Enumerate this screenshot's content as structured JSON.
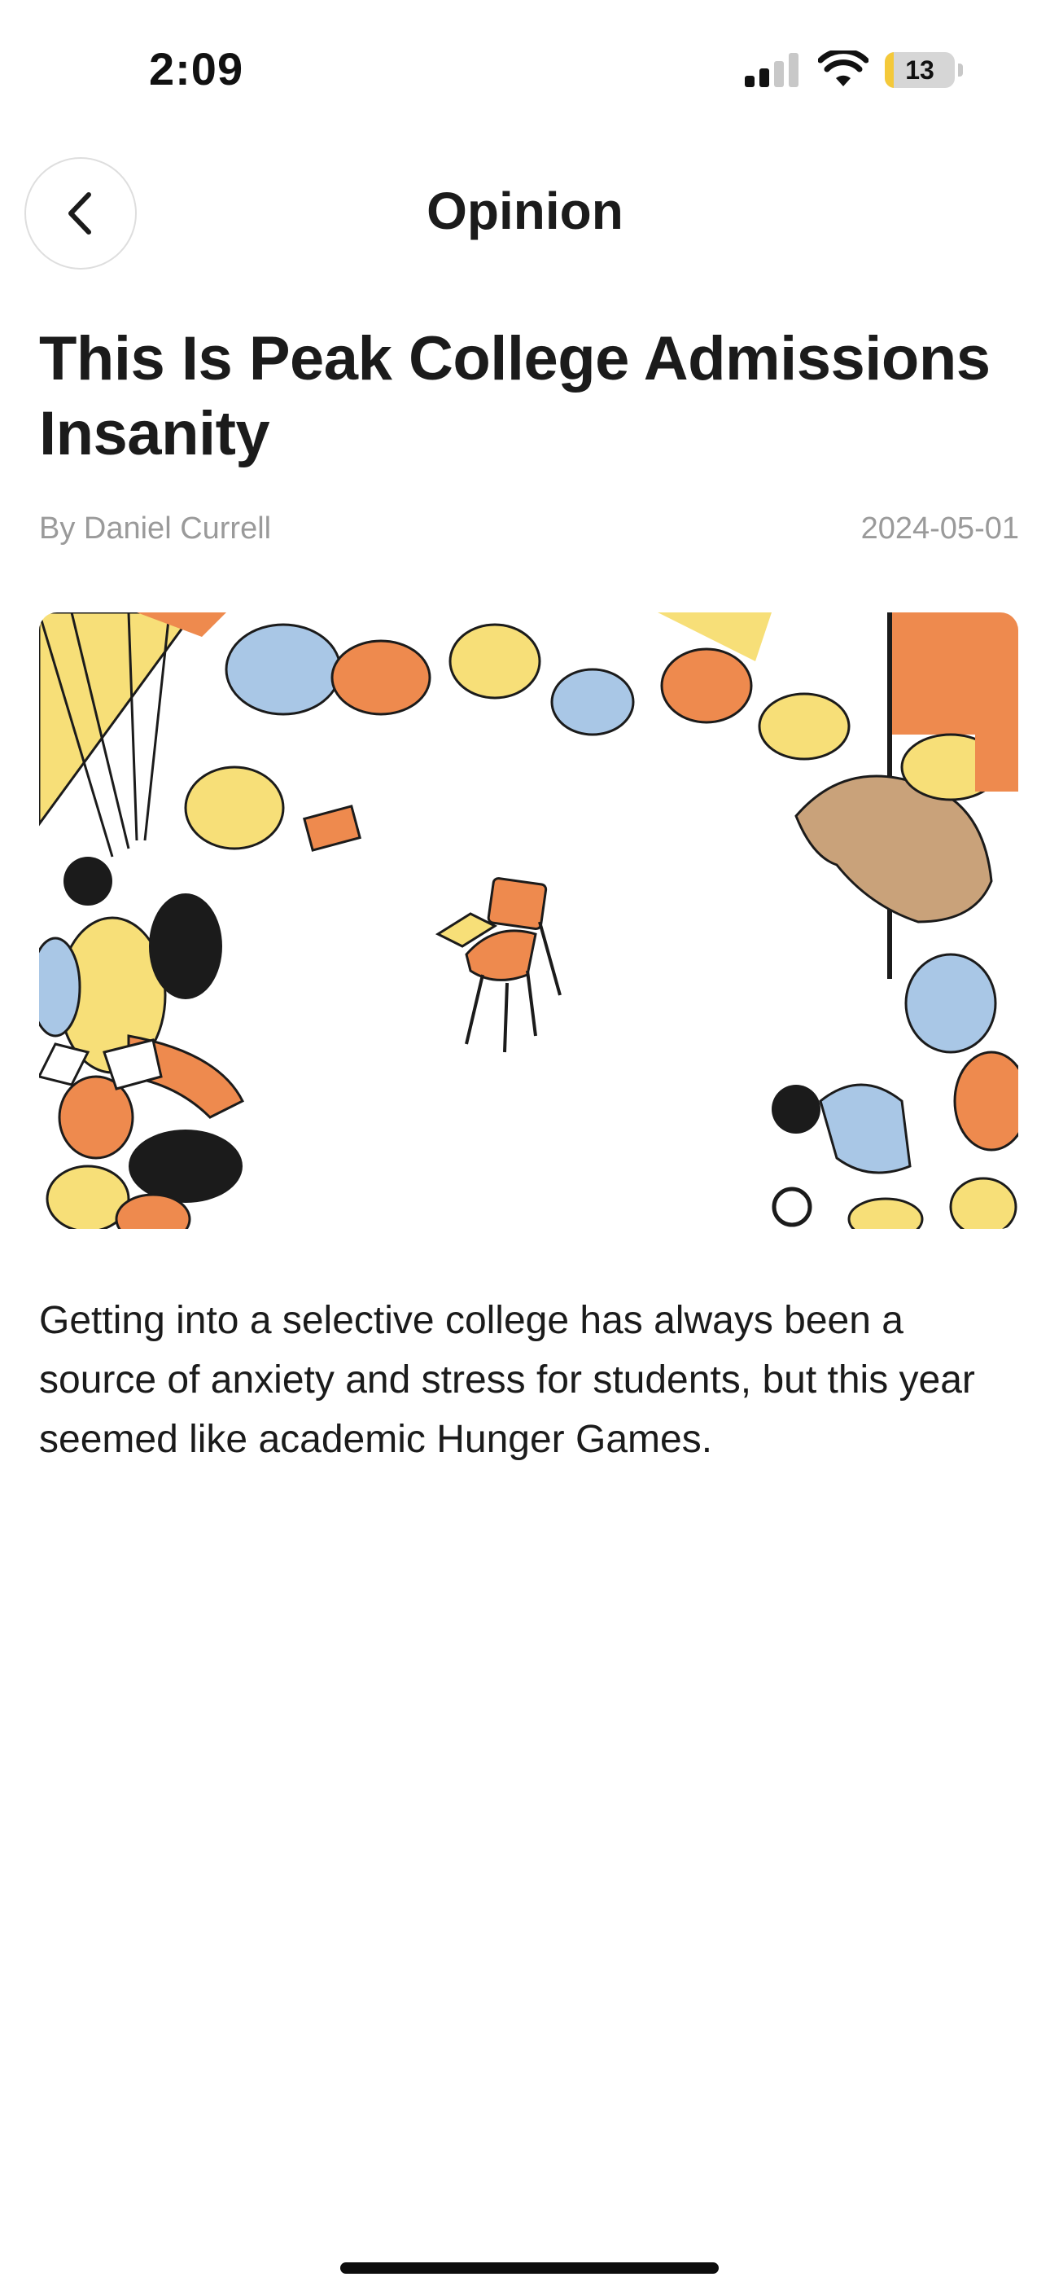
{
  "status_bar": {
    "time": "2:09",
    "signal_bars_active": 2,
    "signal_bars_total": 4,
    "battery_level": "13",
    "battery_fraction": 0.13,
    "battery_color": "#f4c93a"
  },
  "nav": {
    "back_icon": "chevron-left-icon",
    "title": "Opinion"
  },
  "article": {
    "headline": "This Is Peak College Admissions Insanity",
    "byline": "By Daniel Currell",
    "date": "2024-05-01",
    "summary": "Getting into a selective college has always been a source of anxiety and stress for students, but this year seemed like academic Hunger Games."
  },
  "colors": {
    "text": "#1b1b1b",
    "muted": "#9a9a9a",
    "illustration_orange": "#ee8a4e",
    "illustration_yellow": "#f7df78",
    "illustration_blue": "#a9c7e6"
  }
}
